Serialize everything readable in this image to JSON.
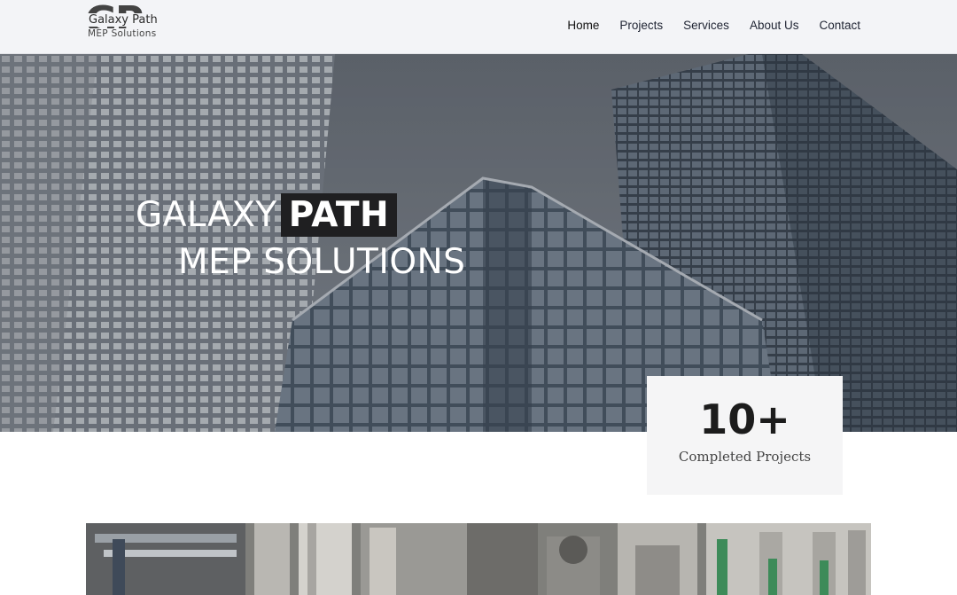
{
  "header": {
    "logo": {
      "mark": "GP",
      "title": "Galaxy Path",
      "subtitle": "MEP Solutions"
    },
    "nav": [
      {
        "label": "Home",
        "active": true
      },
      {
        "label": "Projects"
      },
      {
        "label": "Services"
      },
      {
        "label": "About Us"
      },
      {
        "label": "Contact"
      }
    ]
  },
  "hero": {
    "title_part1": "GALAXY",
    "title_highlight": "PATH",
    "title_line2": "MEP SOLUTIONS",
    "background": "glass office towers photo"
  },
  "stats": {
    "number": "10+",
    "label": "Completed Projects"
  },
  "colors": {
    "header_bg": "#f3f4f7",
    "highlight_bg": "#1f1f21",
    "card_bg": "#f5f5f6",
    "text_dark": "#1c1c1c"
  }
}
